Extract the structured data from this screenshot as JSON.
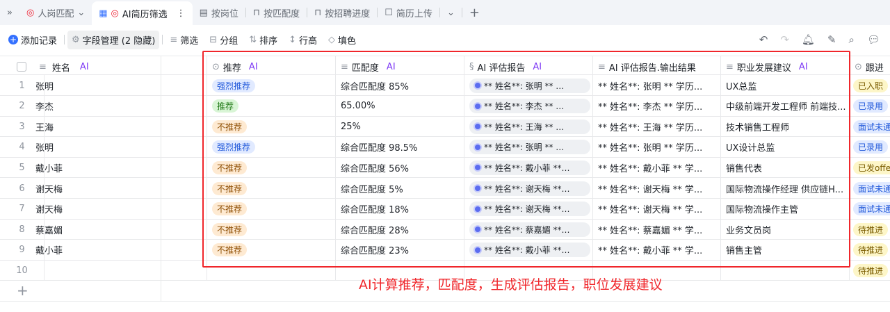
{
  "tabs": [
    {
      "label": "人岗匹配",
      "icon": "target-icon"
    },
    {
      "label": "AI简历筛选",
      "icon": "grid-icon"
    },
    {
      "label": "按岗位",
      "icon": "table-icon"
    },
    {
      "label": "按匹配度",
      "icon": "kanban-icon"
    },
    {
      "label": "按招聘进度",
      "icon": "kanban-icon"
    },
    {
      "label": "简历上传",
      "icon": "form-icon"
    }
  ],
  "toolbar": {
    "add": "添加记录",
    "fields": "字段管理 (2 隐藏)",
    "filter": "筛选",
    "group": "分组",
    "sort": "排序",
    "height": "行高",
    "fill": "填色"
  },
  "columns": {
    "name": "姓名",
    "recommend": "推荐",
    "match": "匹配度",
    "report": "AI 评估报告",
    "output": "AI 评估报告.输出结果",
    "career": "职业发展建议",
    "follow": "跟进",
    "ai": "AI"
  },
  "rows": [
    {
      "n": "1",
      "name": "张明",
      "rec": "强烈推荐",
      "match": "综合匹配度 85%",
      "report": "** 姓名**: 张明 ** …",
      "output": "** 姓名**: 张明 ** 学历...",
      "career": "UX总监",
      "follow": "已入职"
    },
    {
      "n": "2",
      "name": "李杰",
      "rec": "推荐",
      "match": "65.00%",
      "report": "** 姓名**: 李杰 ** …",
      "output": "** 姓名**: 李杰 ** 学历...",
      "career": "中级前端开发工程师 前端技...",
      "follow": "已录用"
    },
    {
      "n": "3",
      "name": "王海",
      "rec": "不推荐",
      "match": "25%",
      "report": "** 姓名**: 王海 ** …",
      "output": "** 姓名**: 王海 ** 学历...",
      "career": "技术销售工程师",
      "follow": "面试未通"
    },
    {
      "n": "4",
      "name": "张明",
      "rec": "强烈推荐",
      "match": "综合匹配度 98.5%",
      "report": "** 姓名**: 张明 ** …",
      "output": "** 姓名**: 张明 ** 学历...",
      "career": "UX设计总监",
      "follow": "已录用"
    },
    {
      "n": "5",
      "name": "戴小菲",
      "rec": "不推荐",
      "match": "综合匹配度 56%",
      "report": "** 姓名**: 戴小菲 **…",
      "output": "** 姓名**: 戴小菲 ** 学...",
      "career": "销售代表",
      "follow": "已发offer"
    },
    {
      "n": "6",
      "name": "谢天梅",
      "rec": "不推荐",
      "match": "综合匹配度 5%",
      "report": "** 姓名**: 谢天梅 **…",
      "output": "** 姓名**: 谢天梅 ** 学...",
      "career": "国际物流操作经理 供应链H...",
      "follow": "面试未通"
    },
    {
      "n": "7",
      "name": "谢天梅",
      "rec": "不推荐",
      "match": "综合匹配度 18%",
      "report": "** 姓名**: 谢天梅 **…",
      "output": "** 姓名**: 谢天梅 ** 学...",
      "career": "国际物流操作主管",
      "follow": "面试未通"
    },
    {
      "n": "8",
      "name": "蔡嘉媚",
      "rec": "不推荐",
      "match": "综合匹配度 28%",
      "report": "** 姓名**: 蔡嘉媚 **…",
      "output": "** 姓名**: 蔡嘉媚 ** 学...",
      "career": "业务文员岗",
      "follow": "待推进"
    },
    {
      "n": "9",
      "name": "戴小菲",
      "rec": "不推荐",
      "match": "综合匹配度 23%",
      "report": "** 姓名**: 戴小菲 **…",
      "output": "** 姓名**: 戴小菲 ** 学...",
      "career": "销售主管",
      "follow": "待推进"
    },
    {
      "n": "10",
      "name": "",
      "rec": "",
      "match": "",
      "report": "",
      "output": "",
      "career": "",
      "follow": "待推进"
    }
  ],
  "annotation": "AI计算推荐，匹配度，生成评估报告，职位发展建议",
  "colors": {
    "accent": "#7f3bf5",
    "red": "#f0262b"
  }
}
